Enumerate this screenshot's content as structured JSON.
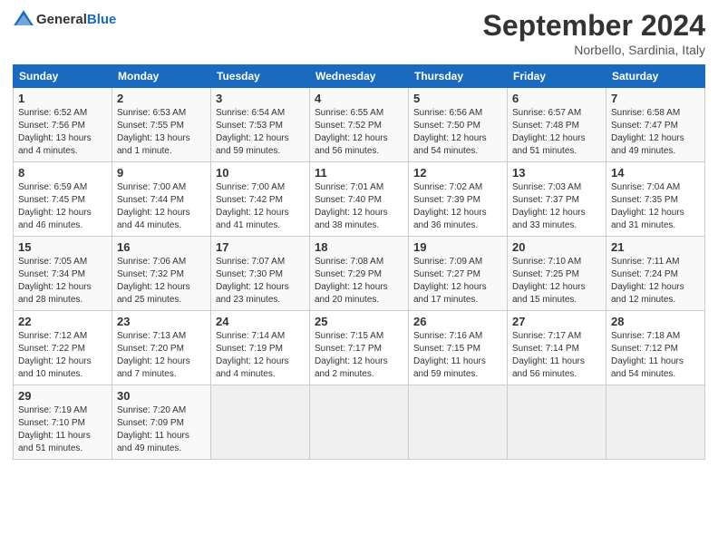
{
  "header": {
    "logo_general": "General",
    "logo_blue": "Blue",
    "title": "September 2024",
    "location": "Norbello, Sardinia, Italy"
  },
  "days_of_week": [
    "Sunday",
    "Monday",
    "Tuesday",
    "Wednesday",
    "Thursday",
    "Friday",
    "Saturday"
  ],
  "weeks": [
    [
      {
        "day": "1",
        "info": "Sunrise: 6:52 AM\nSunset: 7:56 PM\nDaylight: 13 hours\nand 4 minutes."
      },
      {
        "day": "2",
        "info": "Sunrise: 6:53 AM\nSunset: 7:55 PM\nDaylight: 13 hours\nand 1 minute."
      },
      {
        "day": "3",
        "info": "Sunrise: 6:54 AM\nSunset: 7:53 PM\nDaylight: 12 hours\nand 59 minutes."
      },
      {
        "day": "4",
        "info": "Sunrise: 6:55 AM\nSunset: 7:52 PM\nDaylight: 12 hours\nand 56 minutes."
      },
      {
        "day": "5",
        "info": "Sunrise: 6:56 AM\nSunset: 7:50 PM\nDaylight: 12 hours\nand 54 minutes."
      },
      {
        "day": "6",
        "info": "Sunrise: 6:57 AM\nSunset: 7:48 PM\nDaylight: 12 hours\nand 51 minutes."
      },
      {
        "day": "7",
        "info": "Sunrise: 6:58 AM\nSunset: 7:47 PM\nDaylight: 12 hours\nand 49 minutes."
      }
    ],
    [
      {
        "day": "8",
        "info": "Sunrise: 6:59 AM\nSunset: 7:45 PM\nDaylight: 12 hours\nand 46 minutes."
      },
      {
        "day": "9",
        "info": "Sunrise: 7:00 AM\nSunset: 7:44 PM\nDaylight: 12 hours\nand 44 minutes."
      },
      {
        "day": "10",
        "info": "Sunrise: 7:00 AM\nSunset: 7:42 PM\nDaylight: 12 hours\nand 41 minutes."
      },
      {
        "day": "11",
        "info": "Sunrise: 7:01 AM\nSunset: 7:40 PM\nDaylight: 12 hours\nand 38 minutes."
      },
      {
        "day": "12",
        "info": "Sunrise: 7:02 AM\nSunset: 7:39 PM\nDaylight: 12 hours\nand 36 minutes."
      },
      {
        "day": "13",
        "info": "Sunrise: 7:03 AM\nSunset: 7:37 PM\nDaylight: 12 hours\nand 33 minutes."
      },
      {
        "day": "14",
        "info": "Sunrise: 7:04 AM\nSunset: 7:35 PM\nDaylight: 12 hours\nand 31 minutes."
      }
    ],
    [
      {
        "day": "15",
        "info": "Sunrise: 7:05 AM\nSunset: 7:34 PM\nDaylight: 12 hours\nand 28 minutes."
      },
      {
        "day": "16",
        "info": "Sunrise: 7:06 AM\nSunset: 7:32 PM\nDaylight: 12 hours\nand 25 minutes."
      },
      {
        "day": "17",
        "info": "Sunrise: 7:07 AM\nSunset: 7:30 PM\nDaylight: 12 hours\nand 23 minutes."
      },
      {
        "day": "18",
        "info": "Sunrise: 7:08 AM\nSunset: 7:29 PM\nDaylight: 12 hours\nand 20 minutes."
      },
      {
        "day": "19",
        "info": "Sunrise: 7:09 AM\nSunset: 7:27 PM\nDaylight: 12 hours\nand 17 minutes."
      },
      {
        "day": "20",
        "info": "Sunrise: 7:10 AM\nSunset: 7:25 PM\nDaylight: 12 hours\nand 15 minutes."
      },
      {
        "day": "21",
        "info": "Sunrise: 7:11 AM\nSunset: 7:24 PM\nDaylight: 12 hours\nand 12 minutes."
      }
    ],
    [
      {
        "day": "22",
        "info": "Sunrise: 7:12 AM\nSunset: 7:22 PM\nDaylight: 12 hours\nand 10 minutes."
      },
      {
        "day": "23",
        "info": "Sunrise: 7:13 AM\nSunset: 7:20 PM\nDaylight: 12 hours\nand 7 minutes."
      },
      {
        "day": "24",
        "info": "Sunrise: 7:14 AM\nSunset: 7:19 PM\nDaylight: 12 hours\nand 4 minutes."
      },
      {
        "day": "25",
        "info": "Sunrise: 7:15 AM\nSunset: 7:17 PM\nDaylight: 12 hours\nand 2 minutes."
      },
      {
        "day": "26",
        "info": "Sunrise: 7:16 AM\nSunset: 7:15 PM\nDaylight: 11 hours\nand 59 minutes."
      },
      {
        "day": "27",
        "info": "Sunrise: 7:17 AM\nSunset: 7:14 PM\nDaylight: 11 hours\nand 56 minutes."
      },
      {
        "day": "28",
        "info": "Sunrise: 7:18 AM\nSunset: 7:12 PM\nDaylight: 11 hours\nand 54 minutes."
      }
    ],
    [
      {
        "day": "29",
        "info": "Sunrise: 7:19 AM\nSunset: 7:10 PM\nDaylight: 11 hours\nand 51 minutes."
      },
      {
        "day": "30",
        "info": "Sunrise: 7:20 AM\nSunset: 7:09 PM\nDaylight: 11 hours\nand 49 minutes."
      },
      {
        "day": "",
        "info": ""
      },
      {
        "day": "",
        "info": ""
      },
      {
        "day": "",
        "info": ""
      },
      {
        "day": "",
        "info": ""
      },
      {
        "day": "",
        "info": ""
      }
    ]
  ]
}
